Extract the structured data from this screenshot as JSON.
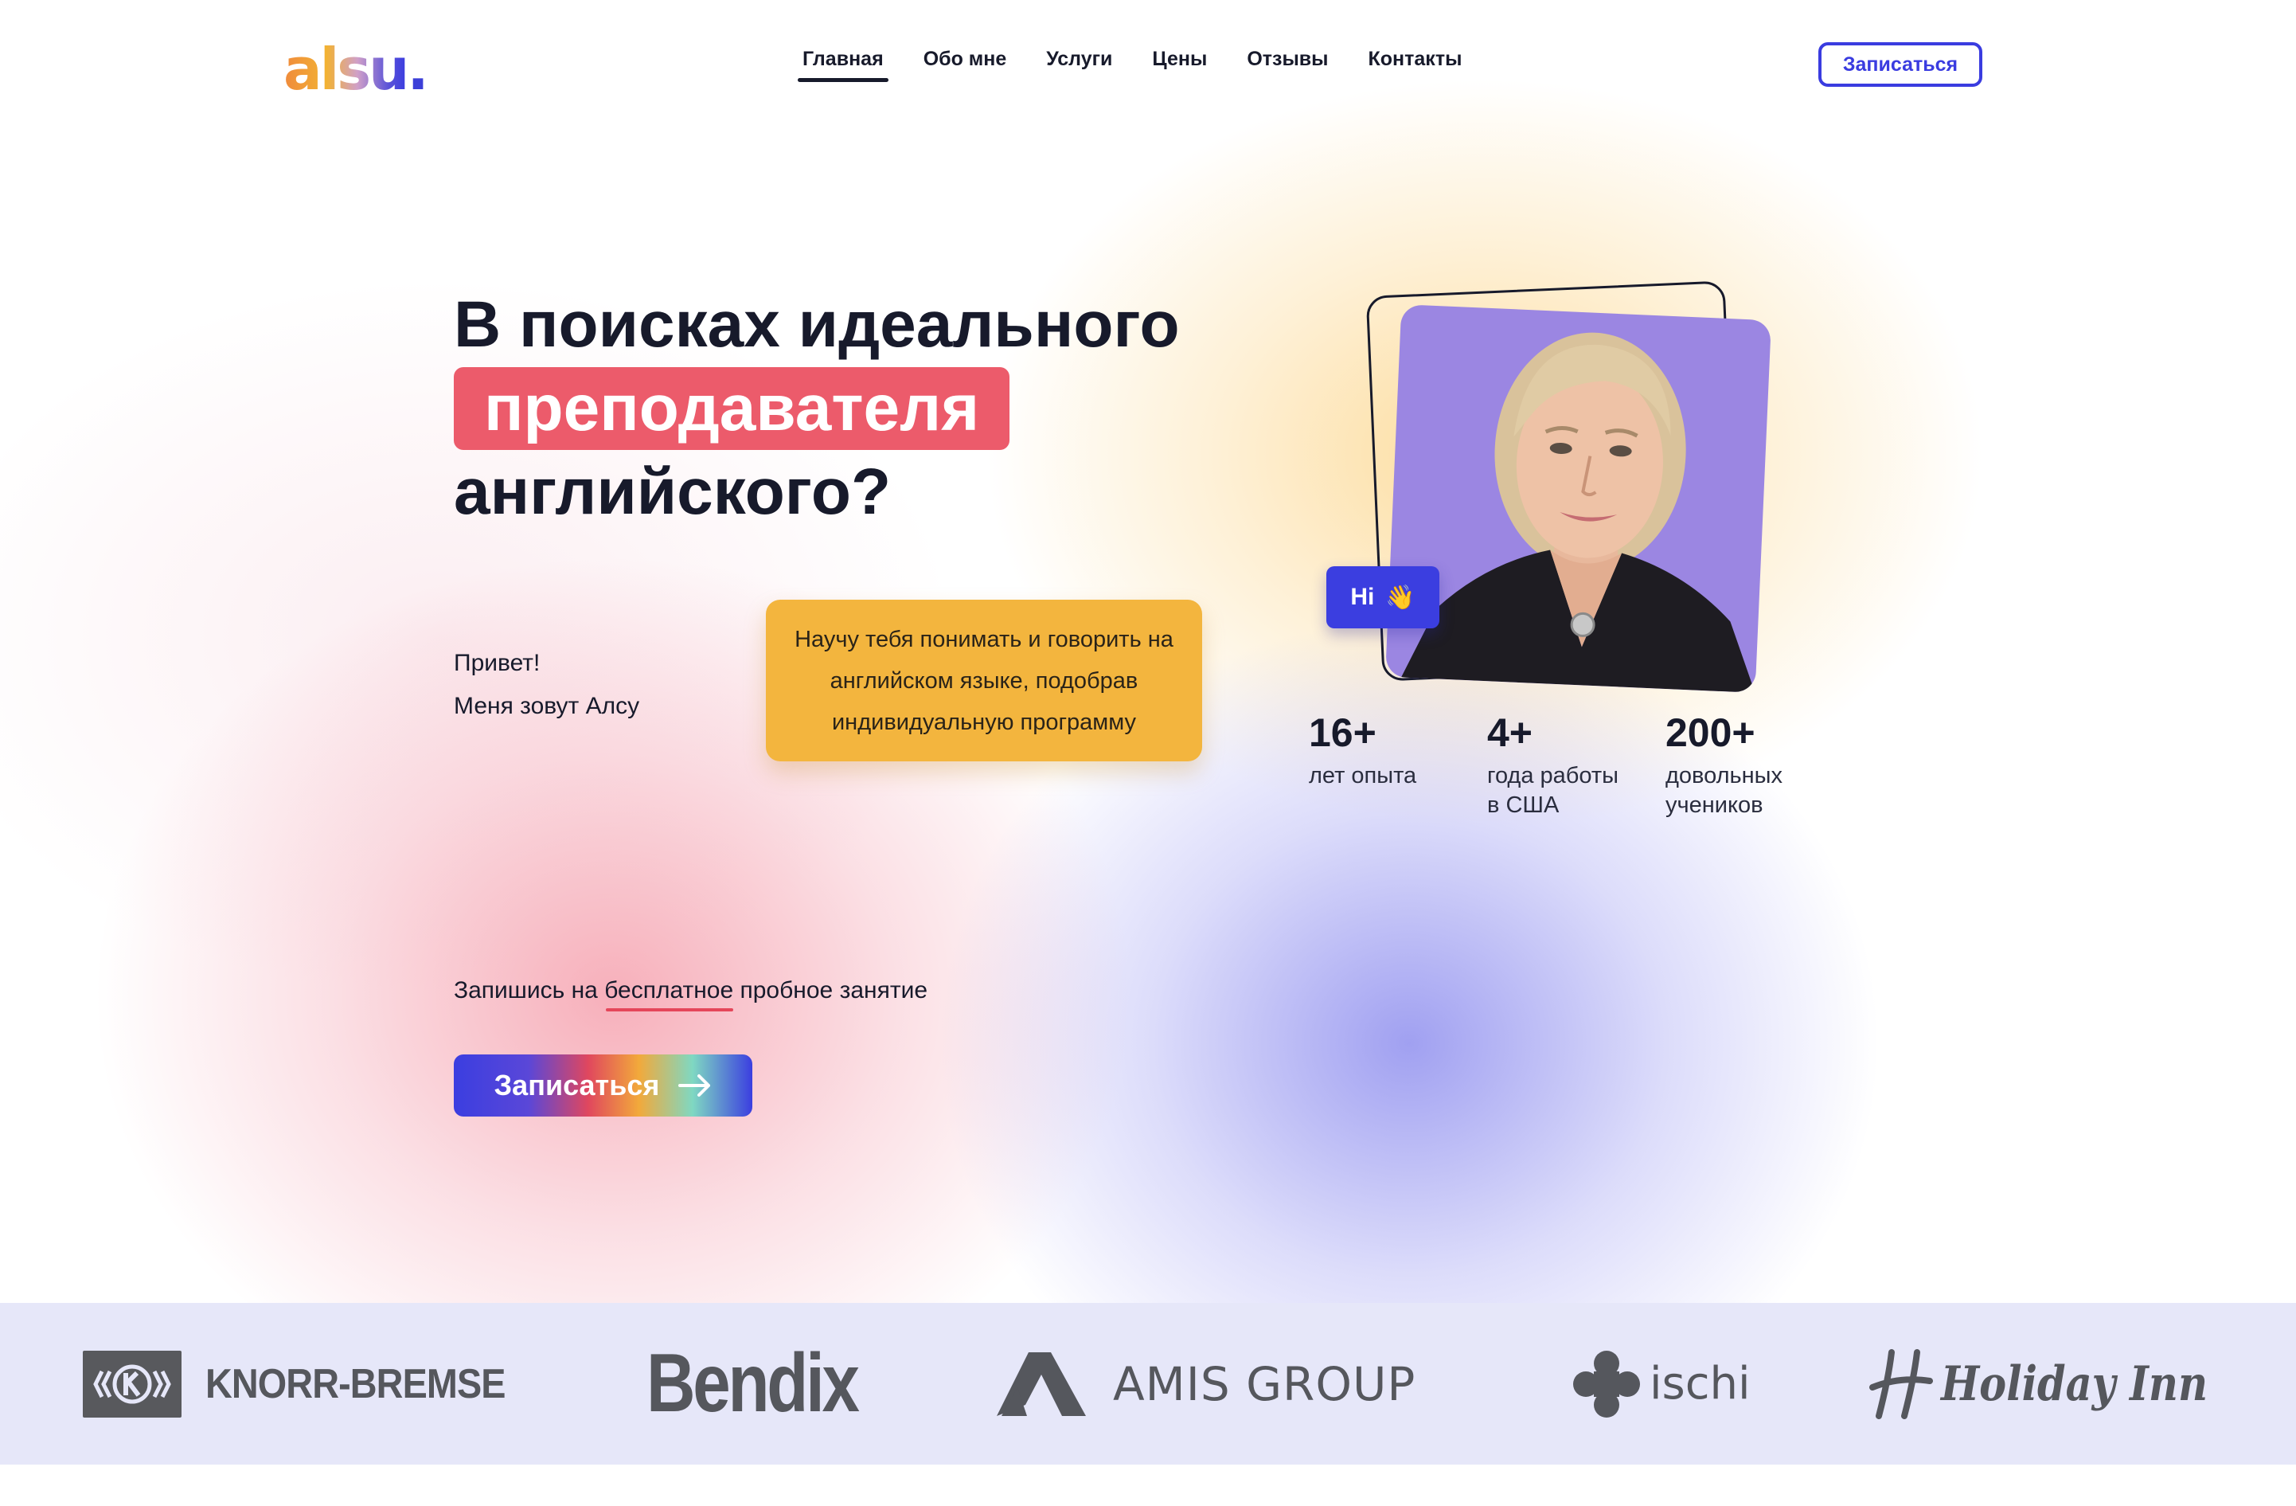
{
  "header": {
    "logo_text": "alsu",
    "logo_dot": ".",
    "nav": [
      {
        "label": "Главная",
        "active": true
      },
      {
        "label": "Обо мне"
      },
      {
        "label": "Услуги"
      },
      {
        "label": "Цены"
      },
      {
        "label": "Отзывы"
      },
      {
        "label": "Контакты"
      }
    ],
    "cta_label": "Записаться"
  },
  "hero": {
    "title_line1": "В поисках идеального",
    "title_highlight": "преподавателя",
    "title_line3": "английского?",
    "greeting_line1": "Привет!",
    "greeting_line2": "Меня зовут Алсу",
    "bubble_text": "Научу тебя понимать и говорить на английском языке, подобрав индивидуальную программу",
    "hi_badge": "Hi",
    "hi_icon": "waving-hand-icon"
  },
  "stats": [
    {
      "value": "16+",
      "label_line1": "лет опыта",
      "label_line2": ""
    },
    {
      "value": "4+",
      "label_line1": "года работы",
      "label_line2": "в США"
    },
    {
      "value": "200+",
      "label_line1": "довольных",
      "label_line2": "учеников"
    }
  ],
  "cta": {
    "text_before": "Запишись на ",
    "text_underlined": "бесплатное",
    "text_after": " пробное занятие",
    "button_label": "Записаться",
    "button_icon": "arrow-right-icon"
  },
  "clients": [
    "KNORR-BREMSE",
    "Bendix",
    "AMIS GROUP",
    "ischi",
    "Holiday Inn"
  ],
  "colors": {
    "accent_blue": "#3a3ce0",
    "highlight_red": "#ec5b6b",
    "bubble_yellow": "#f3b53e",
    "photo_bg": "#9b86e2",
    "strip_bg": "#e6e7f9"
  }
}
